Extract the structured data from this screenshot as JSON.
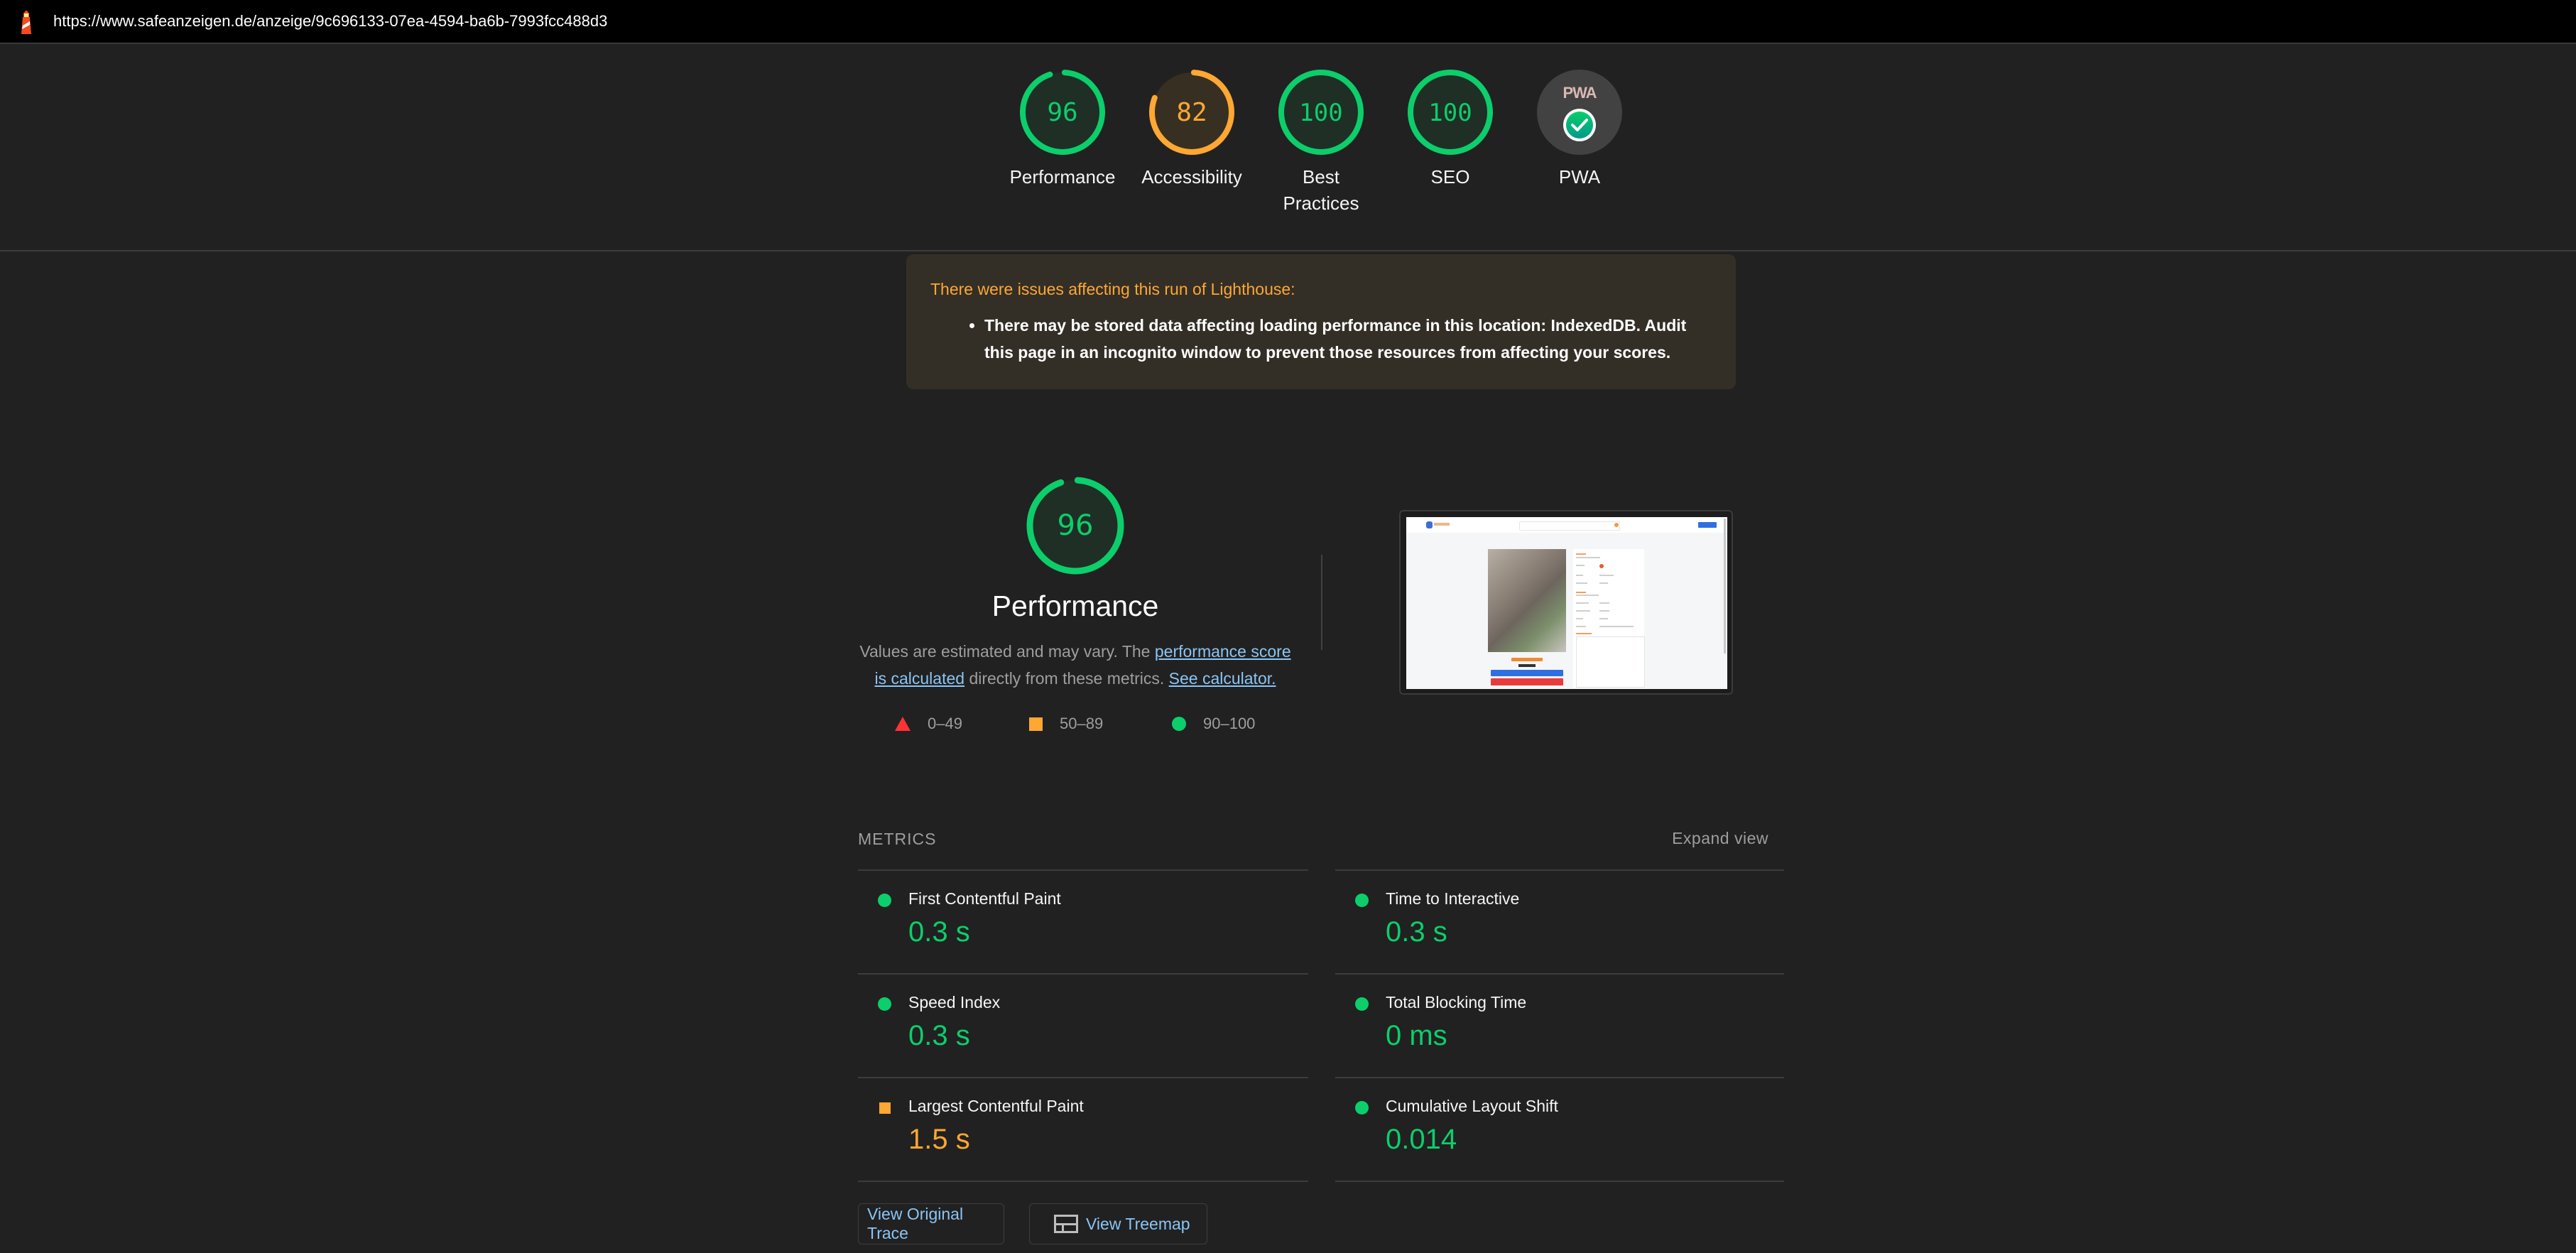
{
  "topbar": {
    "url": "https://www.safeanzeigen.de/anzeige/9c696133-07ea-4594-ba6b-7993fcc488d3",
    "icon": "lighthouse-icon"
  },
  "colors": {
    "pass": "#0cce6b",
    "average": "#ffa733",
    "fail": "#ff3333",
    "link": "#8ac5f4",
    "background": "#212121"
  },
  "gauges": [
    {
      "label": "Performance",
      "score": 96,
      "status": "pass"
    },
    {
      "label": "Accessibility",
      "score": 82,
      "status": "average"
    },
    {
      "label": "Best Practices",
      "score": 100,
      "status": "pass"
    },
    {
      "label": "SEO",
      "score": 100,
      "status": "pass"
    },
    {
      "label": "PWA",
      "score": null,
      "badge_text": "PWA",
      "status": "pwa-check",
      "icon": "pwa-check-icon"
    }
  ],
  "warning": {
    "title": "There were issues affecting this run of Lighthouse:",
    "items": [
      "There may be stored data affecting loading performance in this location: IndexedDB. Audit this page in an incognito window to prevent those resources from affecting your scores."
    ]
  },
  "performance": {
    "score": 96,
    "title": "Performance",
    "desc_prefix": "Values are estimated and may vary. The ",
    "desc_link1": "performance score is calculated",
    "desc_middle": " directly from these metrics. ",
    "desc_link2": "See calculator.",
    "legend": [
      {
        "range": "0–49",
        "shape": "triangle",
        "status": "fail"
      },
      {
        "range": "50–89",
        "shape": "square",
        "status": "average"
      },
      {
        "range": "90–100",
        "shape": "circle",
        "status": "pass"
      }
    ]
  },
  "screenshot": {
    "alt": "Final screenshot of page",
    "listing_title": "Dino im Wald",
    "price": "15,00"
  },
  "metrics": {
    "header": "METRICS",
    "expand_label": "Expand view",
    "left": [
      {
        "name": "First Contentful Paint",
        "value": "0.3 s",
        "status": "pass"
      },
      {
        "name": "Speed Index",
        "value": "0.3 s",
        "status": "pass"
      },
      {
        "name": "Largest Contentful Paint",
        "value": "1.5 s",
        "status": "average"
      }
    ],
    "right": [
      {
        "name": "Time to Interactive",
        "value": "0.3 s",
        "status": "pass"
      },
      {
        "name": "Total Blocking Time",
        "value": "0 ms",
        "status": "pass"
      },
      {
        "name": "Cumulative Layout Shift",
        "value": "0.014",
        "status": "pass"
      }
    ]
  },
  "buttons": {
    "view_trace": "View Original Trace",
    "view_treemap": "View Treemap"
  }
}
